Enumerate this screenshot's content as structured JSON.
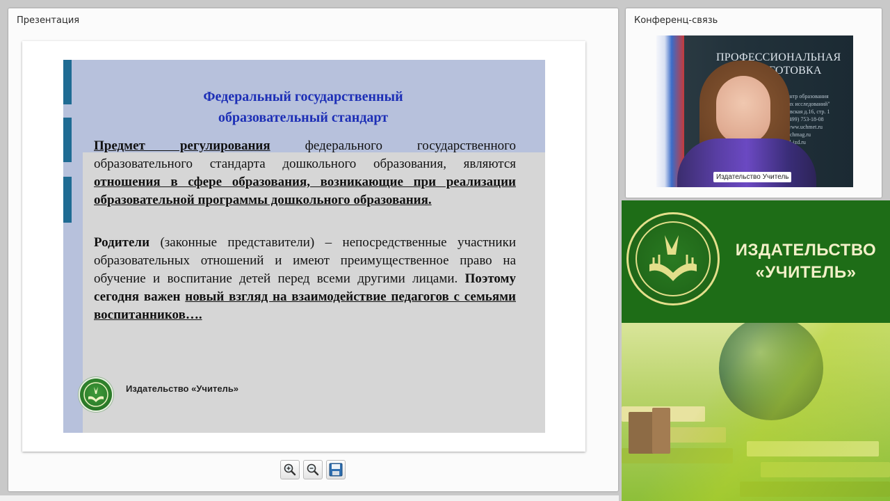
{
  "presentation_panel": {
    "title": "Презентация"
  },
  "conference_panel": {
    "title": "Конференц-связь"
  },
  "slide": {
    "title_line1": "Федеральный государственный",
    "title_line2": "образовательный стандарт",
    "p1": {
      "lead": "Предмет регулирования",
      "text1": " федерального государственного образовательного стандарта дошкольного образования, являются ",
      "emph": "отношения в сфере образования, возникающие при реализации образовательной программы дошкольного образования."
    },
    "p2": {
      "lead": "Родители",
      "text1": " (законные представители) – непосредственные участники образовательных отношений и имеют преимущественное право на обучение и воспитание детей перед всеми другими лицами. ",
      "bold": "Поэтому сегодня важен",
      "space": " ",
      "emph": "новый взгляд на взаимодействие педагогов с семьями воспитанников…."
    },
    "footer": "Издательство «Учитель»"
  },
  "toolbar": {
    "zoom_in_icon": "zoom-in-icon",
    "zoom_out_icon": "zoom-out-icon",
    "save_icon": "save-icon"
  },
  "video": {
    "bg_text_line1": "ПРОФЕССИОНАЛЬНАЯ",
    "bg_text_line2": "ПОДГОТОВКА",
    "bg_small": [
      "ентр образования",
      "ых исследований\"",
      "овская д.16, стр. 1",
      "(499) 753-18-08",
      "www.uchmet.ru",
      "uchmag.ru",
      "el-izd.ru"
    ],
    "speaker_label": "Издательство Учитель"
  },
  "banner": {
    "line1": "ИЗДАТЕЛЬСТВО",
    "line2": "«УЧИТЕЛЬ»"
  },
  "colors": {
    "slide_title": "#1d2fb6",
    "banner_bg": "#1e6d17",
    "banner_text": "#f2f0c8",
    "accent_bar": "#1f6b93"
  }
}
